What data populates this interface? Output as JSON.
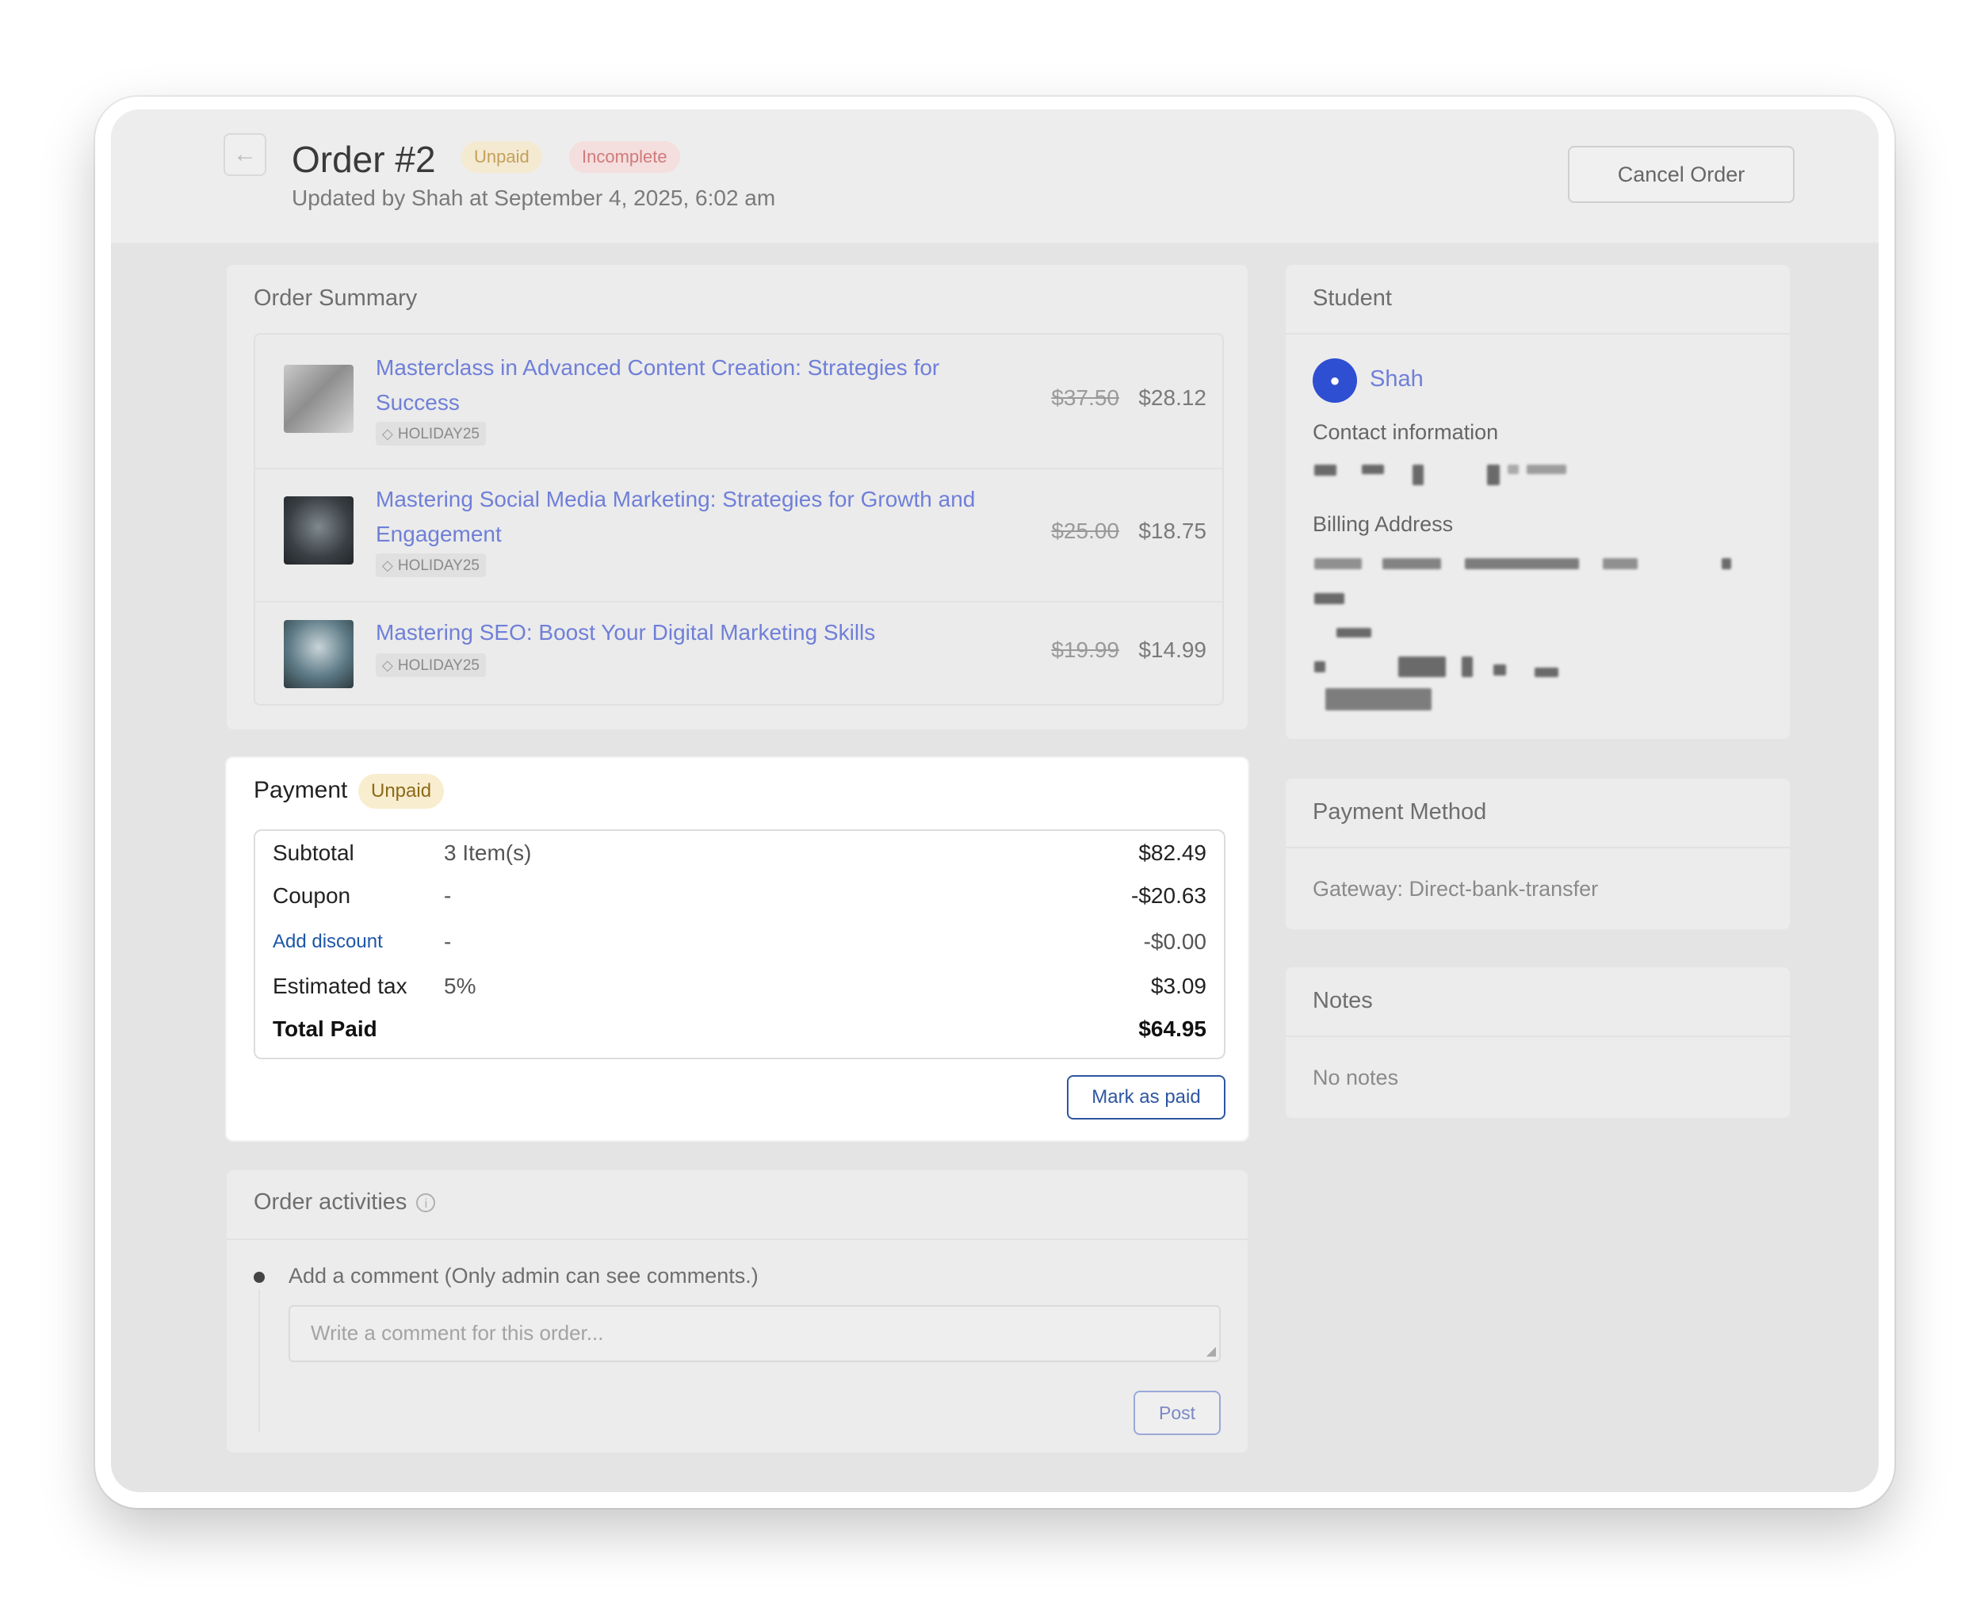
{
  "header": {
    "back_icon": "←",
    "title": "Order #2",
    "badge_unpaid": "Unpaid",
    "badge_incomplete": "Incomplete",
    "updated": "Updated by Shah at September 4, 2025, 6:02 am",
    "cancel_label": "Cancel Order"
  },
  "summary": {
    "title": "Order Summary",
    "items": [
      {
        "name": "Masterclass in Advanced Content Creation: Strategies for Success",
        "coupon": "HOLIDAY25",
        "old_price": "$37.50",
        "price": "$28.12"
      },
      {
        "name": "Mastering Social Media Marketing: Strategies for Growth and Engagement",
        "coupon": "HOLIDAY25",
        "old_price": "$25.00",
        "price": "$18.75"
      },
      {
        "name": "Mastering SEO: Boost Your Digital Marketing Skills",
        "coupon": "HOLIDAY25",
        "old_price": "$19.99",
        "price": "$14.99"
      }
    ]
  },
  "payment": {
    "title": "Payment",
    "badge": "Unpaid",
    "rows": [
      {
        "label": "Subtotal",
        "mid": "3 Item(s)",
        "amount": "$82.49"
      },
      {
        "label": "Coupon",
        "mid": "-",
        "amount": "-$20.63"
      },
      {
        "label": "Add discount",
        "mid": "-",
        "amount": "-$0.00"
      },
      {
        "label": "Estimated tax",
        "mid": "5%",
        "amount": "$3.09"
      },
      {
        "label": "Total Paid",
        "mid": "",
        "amount": "$64.95"
      }
    ],
    "mark_paid_label": "Mark as paid"
  },
  "activities": {
    "title": "Order activities",
    "info_icon": "i",
    "comment_label": "Add a comment (Only admin can see comments.)",
    "comment_placeholder": "Write a comment for this order...",
    "post_label": "Post"
  },
  "student": {
    "title": "Student",
    "name": "Shah",
    "contact_label": "Contact information",
    "billing_label": "Billing Address"
  },
  "payment_method": {
    "title": "Payment Method",
    "gateway": "Gateway: Direct-bank-transfer"
  },
  "notes": {
    "title": "Notes",
    "empty": "No notes"
  },
  "colors": {
    "link": "#6f7fd8",
    "primary": "#2d56a0",
    "unpaid_bg": "#f9edcf",
    "incomplete_bg": "#f4dede"
  }
}
